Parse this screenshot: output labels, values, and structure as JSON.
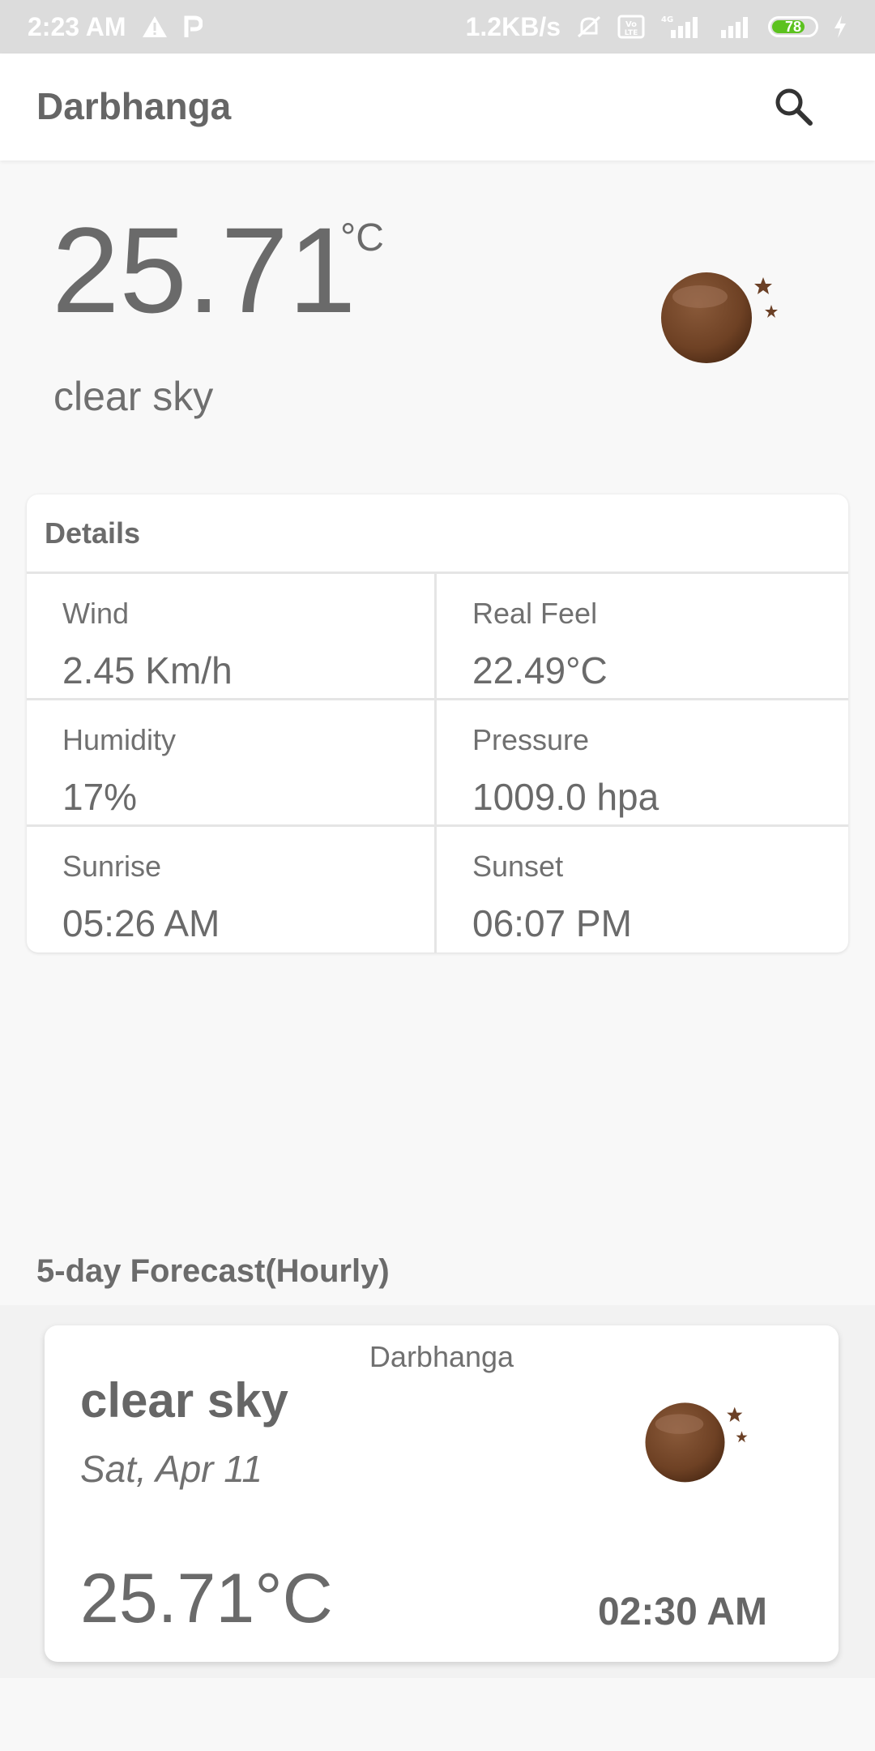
{
  "status_bar": {
    "time": "2:23 AM",
    "network_speed": "1.2KB/s",
    "volte": "Vo LTE",
    "network_type": "4G",
    "battery_level": "78",
    "battery_fraction": 0.78,
    "battery_color": "#5cc21f"
  },
  "app_bar": {
    "title": "Darbhanga",
    "search_icon": "search-icon"
  },
  "current": {
    "temperature": "25.71",
    "unit": "°C",
    "description": "clear sky",
    "icon": "moon-stars-icon"
  },
  "details": {
    "title": "Details",
    "items": [
      {
        "label": "Wind",
        "value": "2.45 Km/h"
      },
      {
        "label": "Real Feel",
        "value": "22.49°C"
      },
      {
        "label": "Humidity",
        "value": "17%"
      },
      {
        "label": "Pressure",
        "value": "1009.0 hpa"
      },
      {
        "label": "Sunrise",
        "value": "05:26 AM"
      },
      {
        "label": "Sunset",
        "value": "06:07 PM"
      }
    ]
  },
  "forecast": {
    "heading": "5-day Forecast(Hourly)",
    "cards": [
      {
        "city": "Darbhanga",
        "description": "clear sky",
        "date": "Sat, Apr 11",
        "temperature": "25.71°C",
        "time": "02:30 AM",
        "icon": "moon-stars-icon"
      }
    ]
  },
  "colors": {
    "background": "#f8f8f8",
    "card": "#ffffff",
    "text": "#6f6f6f",
    "moon": "#7a4a2c"
  }
}
